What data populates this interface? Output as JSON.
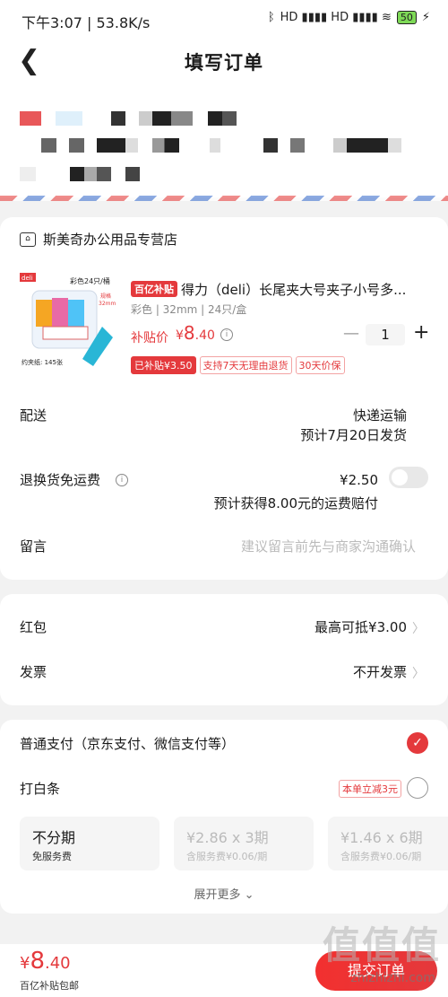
{
  "status": {
    "time": "下午3:07 | 53.8K/s",
    "signal": "HD ▮▮▮▮ HD ▮▮▮▮ ≋",
    "battery": "50",
    "charging": "⚡"
  },
  "nav": {
    "title": "填写订单"
  },
  "shop": {
    "name": "斯美奇办公用品专营店"
  },
  "product": {
    "badge": "百亿补贴",
    "title": "得力（deli）长尾夹大号夹子小号多...",
    "spec": "彩色 | 32mm | 24只/盒",
    "price_label": "补贴价",
    "price_symbol": "¥",
    "price_int": "8",
    "price_dec": ".40",
    "quantity": "1",
    "tags": [
      "已补贴¥3.50",
      "支持7天无理由退货",
      "30天价保"
    ],
    "thumb": {
      "title": "彩色24只/桶",
      "size": "规格\n32mm",
      "count": "约夹纸: 145张",
      "brand": "deli"
    }
  },
  "delivery": {
    "label": "配送",
    "method": "快递运输",
    "eta": "预计7月20日发货"
  },
  "return_fee": {
    "label": "退换货免运费",
    "price": "¥2.50",
    "note": "预计获得8.00元的运费赔付"
  },
  "message": {
    "label": "留言",
    "placeholder": "建议留言前先与商家沟通确认"
  },
  "redpacket": {
    "label": "红包",
    "value": "最高可抵¥3.00"
  },
  "invoice": {
    "label": "发票",
    "value": "不开发票"
  },
  "payment": {
    "normal": "普通支付（京东支付、微信支付等）",
    "baitiao": "打白条",
    "promo": "本单立减3元",
    "plans": [
      {
        "title": "不分期",
        "sub": "免服务费"
      },
      {
        "title": "¥2.86 x 3期",
        "sub": "含服务费¥0.06/期"
      },
      {
        "title": "¥1.46 x 6期",
        "sub": "含服务费¥0.06/期"
      }
    ],
    "expand": "展开更多 ⌄"
  },
  "footer": {
    "symbol": "¥",
    "int": "8",
    "dec": ".40",
    "note": "百亿补贴包邮",
    "submit": "提交订单"
  },
  "watermark": {
    "big": "值值值",
    "url": "zhizhizhi.com"
  },
  "colors": {
    "accent": "#e4393c"
  }
}
